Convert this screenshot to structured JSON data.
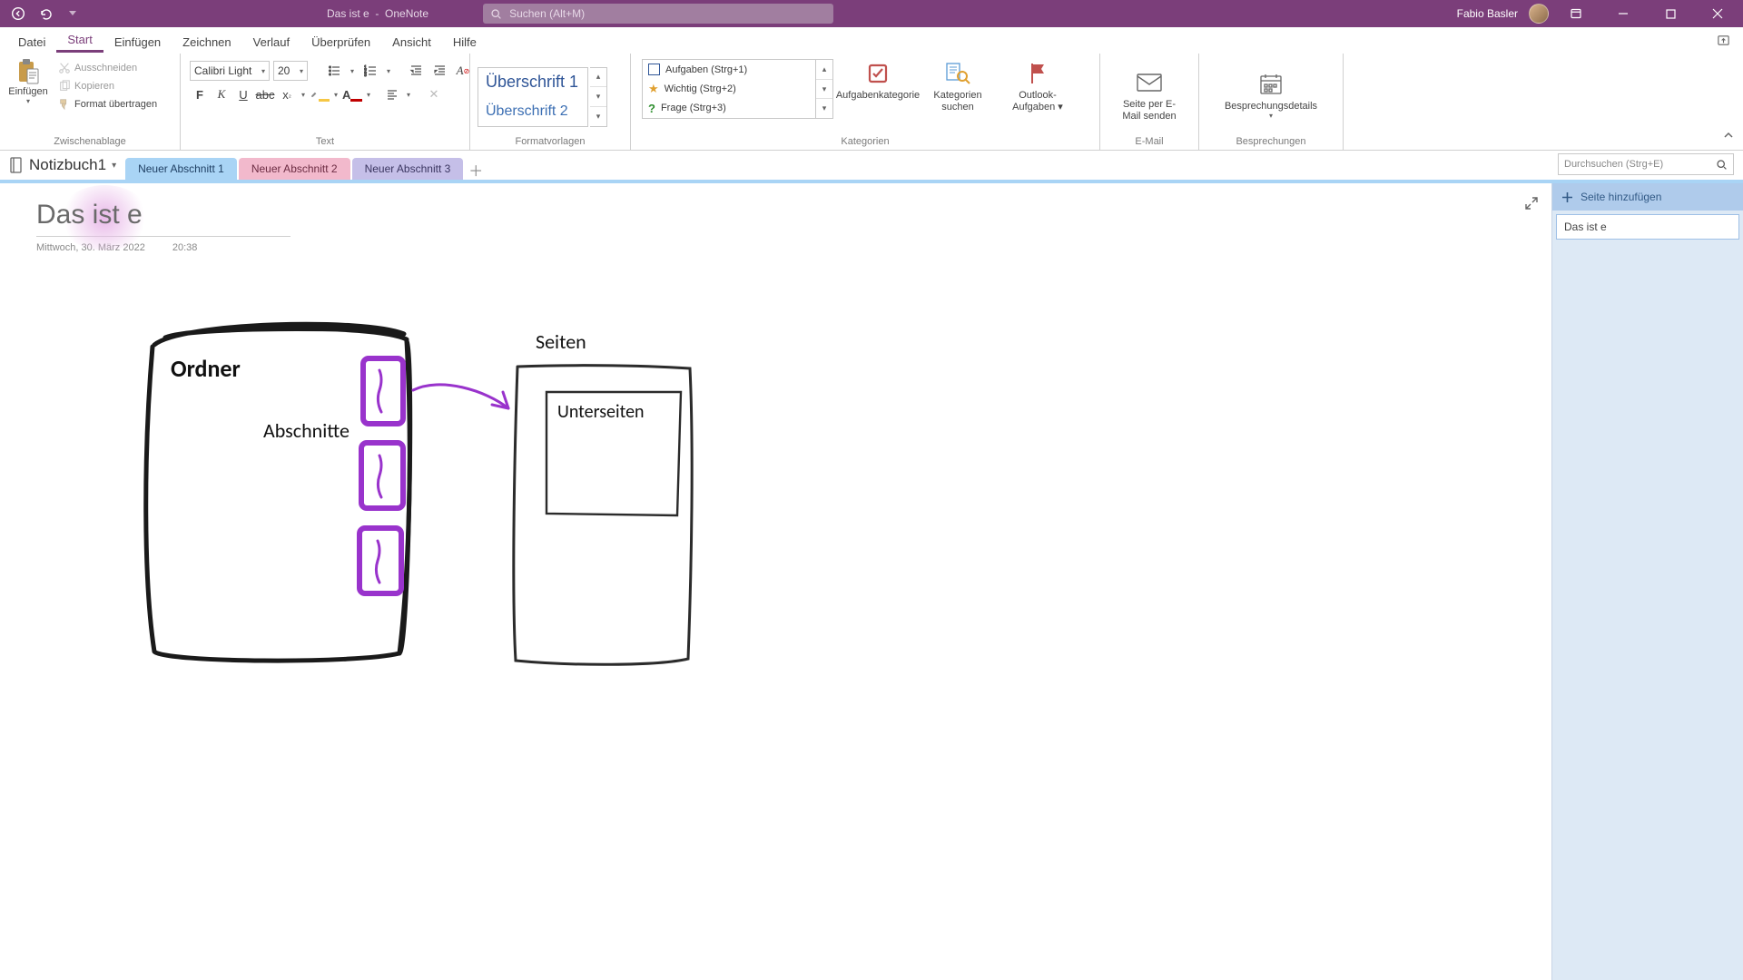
{
  "app": {
    "doc_title": "Das ist e",
    "app_name": "OneNote",
    "search_placeholder": "Suchen (Alt+M)",
    "user": "Fabio Basler"
  },
  "menu_tabs": {
    "datei": "Datei",
    "start": "Start",
    "einfuegen": "Einfügen",
    "zeichnen": "Zeichnen",
    "verlauf": "Verlauf",
    "ueberpruefen": "Überprüfen",
    "ansicht": "Ansicht",
    "hilfe": "Hilfe"
  },
  "ribbon": {
    "clipboard": {
      "paste": "Einfügen",
      "cut": "Ausschneiden",
      "copy": "Kopieren",
      "format_painter": "Format übertragen",
      "label": "Zwischenablage"
    },
    "text": {
      "font_name": "Calibri Light",
      "font_size": "20",
      "label": "Text"
    },
    "styles": {
      "h1": "Überschrift 1",
      "h2": "Überschrift 2",
      "label": "Formatvorlagen"
    },
    "categories": {
      "tag1": "Aufgaben (Strg+1)",
      "tag2": "Wichtig (Strg+2)",
      "tag3": "Frage (Strg+3)",
      "btn_task_cat": "Aufgabenkategorie",
      "btn_find_cat_1": "Kategorien",
      "btn_find_cat_2": "suchen",
      "btn_outlook_1": "Outlook-",
      "btn_outlook_2": "Aufgaben ▾",
      "label": "Kategorien"
    },
    "email": {
      "btn_1": "Seite per E-",
      "btn_2": "Mail senden",
      "label": "E-Mail"
    },
    "meetings": {
      "btn": "Besprechungsdetails",
      "label": "Besprechungen"
    }
  },
  "notebook": {
    "name": "Notizbuch1",
    "sections": {
      "s1": "Neuer Abschnitt 1",
      "s2": "Neuer Abschnitt 2",
      "s3": "Neuer Abschnitt 3"
    },
    "search_placeholder": "Durchsuchen (Strg+E)"
  },
  "page": {
    "title": "Das ist e",
    "date": "Mittwoch, 30. März 2022",
    "time": "20:38",
    "drawing": {
      "ordner": "Ordner",
      "abschnitte": "Abschnitte",
      "seiten": "Seiten",
      "unterseiten": "Unterseiten"
    }
  },
  "side_pane": {
    "add_page": "Seite hinzufügen",
    "page1": "Das ist e"
  },
  "colors": {
    "accent": "#9933CC"
  }
}
